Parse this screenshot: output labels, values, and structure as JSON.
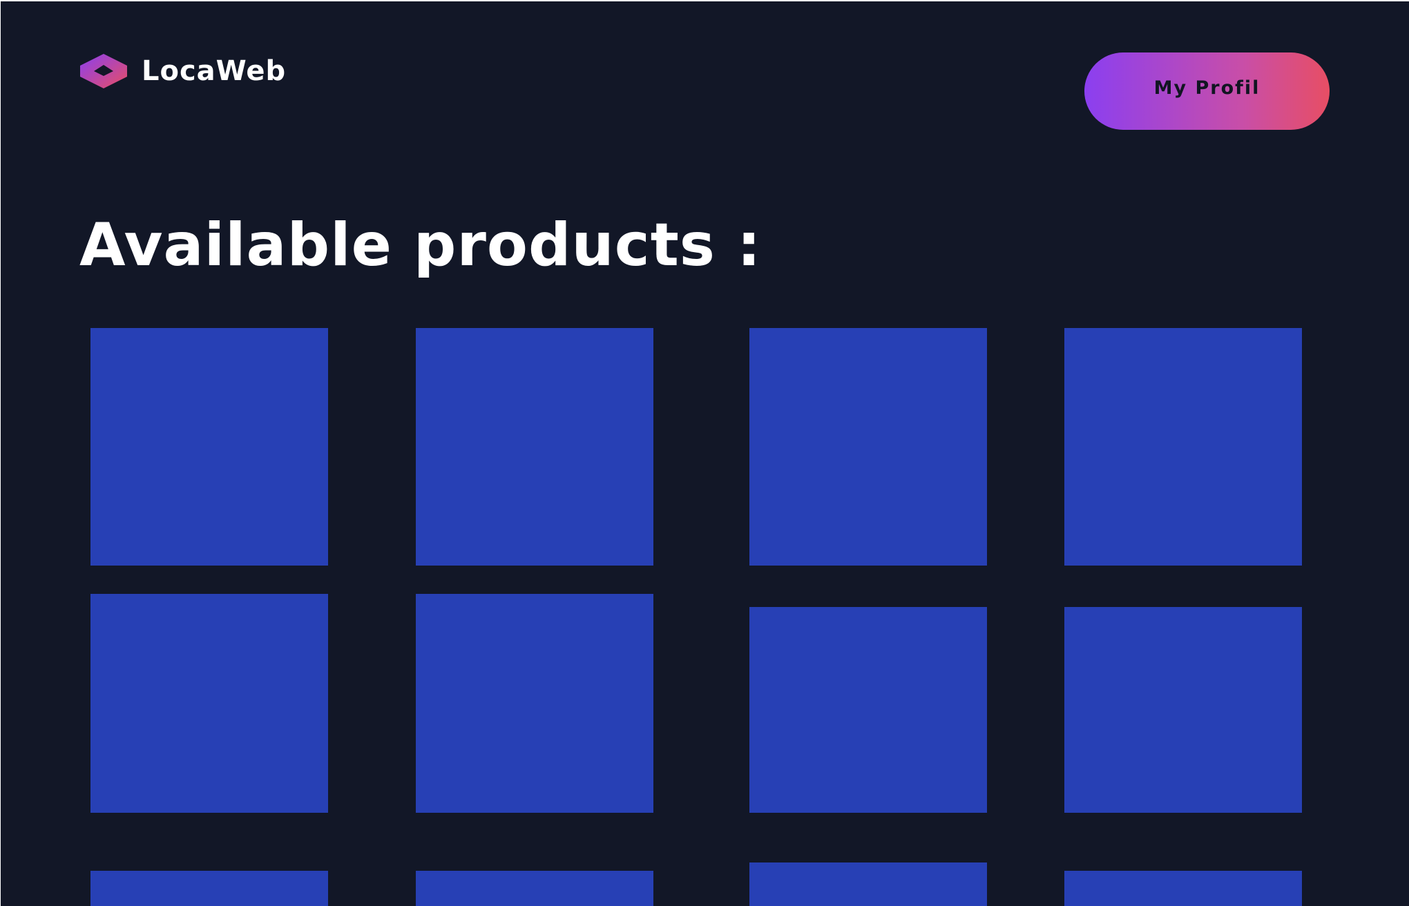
{
  "header": {
    "logo_text": "LocaWeb",
    "logo_icon": "hexagon-logo-icon",
    "profile_button_label": "My Profil"
  },
  "main": {
    "title": "Available products :",
    "product_count_visible": 12
  },
  "colors": {
    "background": "#121727",
    "card": "#2740b5",
    "text": "#ffffff",
    "button_gradient_start": "#8b3ff0",
    "button_gradient_end": "#e74e64",
    "button_text": "#111522"
  }
}
